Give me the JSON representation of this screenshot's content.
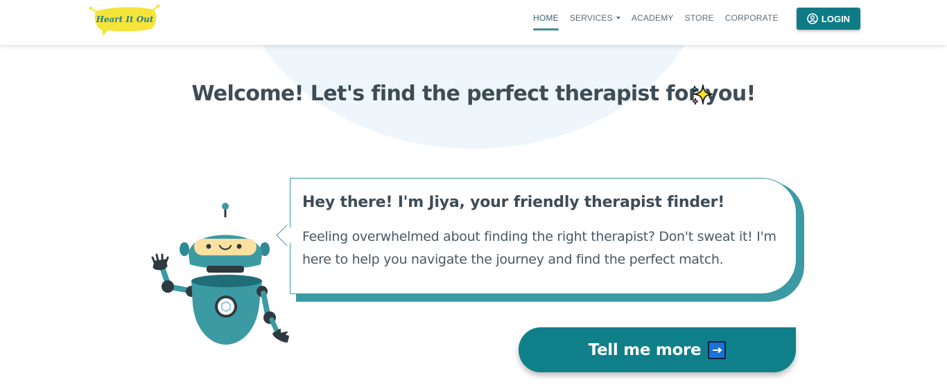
{
  "header": {
    "logo_text": "Heart It Out",
    "nav": [
      {
        "label": "HOME",
        "active": true
      },
      {
        "label": "SERVICES",
        "dropdown": true
      },
      {
        "label": "ACADEMY"
      },
      {
        "label": "STORE"
      },
      {
        "label": "CORPORATE"
      }
    ],
    "login_label": "LOGIN"
  },
  "main": {
    "title": "Welcome! Let's find the perfect therapist for you!",
    "bubble_heading": "Hey there! I'm Jiya, your friendly therapist finder!",
    "bubble_text": "Feeling overwhelmed about finding the right therapist? Don't sweat it! I'm here to help you navigate the journey and find the perfect match.",
    "cta_label": "Tell me more"
  },
  "colors": {
    "primary": "#0f7f89",
    "title_text": "#3d4c57",
    "logo_yellow": "#f5e43a",
    "background_circle": "#eef6fb"
  }
}
